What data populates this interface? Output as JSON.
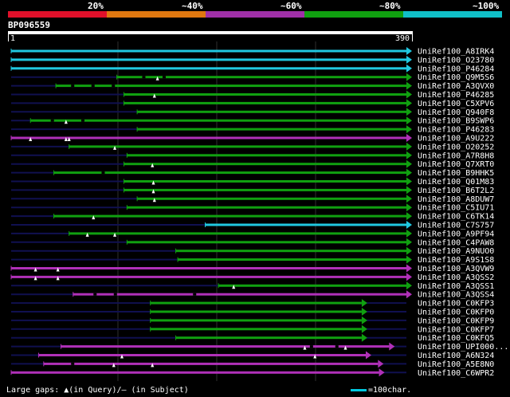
{
  "legend": {
    "labels": [
      "20%",
      "~40%",
      "~60%",
      "~80%",
      "~100%"
    ],
    "colors": [
      "#e0102a",
      "#e07810",
      "#a030a8",
      "#10a010",
      "#10c0c8"
    ]
  },
  "query": {
    "name": "BP096559",
    "start": "1",
    "end": "390",
    "length": 390
  },
  "colors": {
    "faint_line": "#101050",
    "gap_dash": "#000000",
    "gridline": "#303030"
  },
  "hits": [
    {
      "label": "UniRef100_A8IRK4",
      "color": "cyan",
      "start": 1,
      "end": 390,
      "arrow": "tri",
      "gaps": [],
      "marks": []
    },
    {
      "label": "UniRef100_O23780",
      "color": "cyan",
      "start": 1,
      "end": 390,
      "arrow": "tri",
      "gaps": [],
      "marks": []
    },
    {
      "label": "UniRef100_P46284",
      "color": "cyan",
      "start": 1,
      "end": 390,
      "arrow": "tri",
      "gaps": [],
      "marks": []
    },
    {
      "label": "UniRef100_Q9M5S6",
      "color": "green",
      "start": 105,
      "end": 390,
      "arrow": "tri",
      "gaps": [
        130,
        150
      ],
      "marks": [
        145
      ]
    },
    {
      "label": "UniRef100_A3QVX0",
      "color": "green",
      "start": 45,
      "end": 390,
      "arrow": "tri",
      "gaps": [
        60,
        80,
        100
      ],
      "marks": []
    },
    {
      "label": "UniRef100_P46285",
      "color": "green",
      "start": 112,
      "end": 390,
      "arrow": "tri",
      "gaps": [],
      "marks": [
        142
      ]
    },
    {
      "label": "UniRef100_C5XPV6",
      "color": "green",
      "start": 112,
      "end": 390,
      "arrow": "tri",
      "gaps": [],
      "marks": []
    },
    {
      "label": "UniRef100_Q940F8",
      "color": "green",
      "start": 125,
      "end": 390,
      "arrow": "tri",
      "gaps": [],
      "marks": []
    },
    {
      "label": "UniRef100_B9SWP6",
      "color": "green",
      "start": 20,
      "end": 390,
      "arrow": "tri",
      "gaps": [
        40,
        70
      ],
      "marks": [
        55
      ]
    },
    {
      "label": "UniRef100_P46283",
      "color": "green",
      "start": 125,
      "end": 390,
      "arrow": "tri",
      "gaps": [],
      "marks": []
    },
    {
      "label": "UniRef100_A9U222",
      "color": "magenta",
      "start": 1,
      "end": 390,
      "arrow": "tri",
      "gaps": [],
      "marks": [
        20,
        55,
        58
      ]
    },
    {
      "label": "UniRef100_O20252",
      "color": "green",
      "start": 58,
      "end": 390,
      "arrow": "tri",
      "gaps": [],
      "marks": [
        103
      ]
    },
    {
      "label": "UniRef100_A7R8H8",
      "color": "green",
      "start": 115,
      "end": 390,
      "arrow": "tri",
      "gaps": [],
      "marks": []
    },
    {
      "label": "UniRef100_Q7XRT0",
      "color": "green",
      "start": 112,
      "end": 390,
      "arrow": "tri",
      "gaps": [],
      "marks": [
        140
      ]
    },
    {
      "label": "UniRef100_B9HHK5",
      "color": "green",
      "start": 43,
      "end": 390,
      "arrow": "tri",
      "gaps": [
        90
      ],
      "marks": []
    },
    {
      "label": "UniRef100_Q01M83",
      "color": "green",
      "start": 112,
      "end": 390,
      "arrow": "tri",
      "gaps": [],
      "marks": [
        141
      ]
    },
    {
      "label": "UniRef100_B6T2L2",
      "color": "green",
      "start": 112,
      "end": 390,
      "arrow": "tri",
      "gaps": [],
      "marks": [
        141
      ]
    },
    {
      "label": "UniRef100_A8DUW7",
      "color": "green",
      "start": 125,
      "end": 390,
      "arrow": "tri",
      "gaps": [],
      "marks": [
        142
      ]
    },
    {
      "label": "UniRef100_C5IU71",
      "color": "green",
      "start": 115,
      "end": 390,
      "arrow": "tri",
      "gaps": [],
      "marks": []
    },
    {
      "label": "UniRef100_C6TK14",
      "color": "green",
      "start": 43,
      "end": 390,
      "arrow": "tri",
      "gaps": [],
      "marks": [
        82
      ]
    },
    {
      "label": "UniRef100_C7S757",
      "color": "cyan",
      "start": 192,
      "end": 390,
      "arrow": "tri",
      "gaps": [],
      "marks": []
    },
    {
      "label": "UniRef100_A9PF94",
      "color": "green",
      "start": 58,
      "end": 390,
      "arrow": "tri",
      "gaps": [],
      "marks": [
        76,
        103
      ]
    },
    {
      "label": "UniRef100_C4PAW8",
      "color": "green",
      "start": 115,
      "end": 390,
      "arrow": "tri",
      "gaps": [],
      "marks": []
    },
    {
      "label": "UniRef100_A9NUO0",
      "color": "green",
      "start": 163,
      "end": 390,
      "arrow": "tri",
      "gaps": [],
      "marks": []
    },
    {
      "label": "UniRef100_A9S1S8",
      "color": "green",
      "start": 165,
      "end": 390,
      "arrow": "tri",
      "gaps": [],
      "marks": []
    },
    {
      "label": "UniRef100_A3QVW9",
      "color": "magenta",
      "start": 1,
      "end": 390,
      "arrow": "tri",
      "gaps": [],
      "marks": [
        25,
        47
      ]
    },
    {
      "label": "UniRef100_A3QSS2",
      "color": "magenta",
      "start": 1,
      "end": 390,
      "arrow": "tri",
      "gaps": [],
      "marks": [
        25,
        47
      ]
    },
    {
      "label": "UniRef100_A3QSS1",
      "color": "green",
      "start": 205,
      "end": 390,
      "arrow": "tri",
      "gaps": [],
      "marks": [
        220
      ]
    },
    {
      "label": "UniRef100_A3QSS4",
      "color": "magenta",
      "start": 62,
      "end": 390,
      "arrow": "tri",
      "gaps": [
        82,
        102,
        180
      ],
      "marks": []
    },
    {
      "label": "UniRef100_C0KFP3",
      "color": "green",
      "start": 138,
      "end": 346,
      "arrow": "tri",
      "gaps": [],
      "marks": []
    },
    {
      "label": "UniRef100_C0KFP0",
      "color": "green",
      "start": 138,
      "end": 346,
      "arrow": "tri",
      "gaps": [],
      "marks": []
    },
    {
      "label": "UniRef100_C0KFP9",
      "color": "green",
      "start": 138,
      "end": 346,
      "arrow": "tri",
      "gaps": [],
      "marks": []
    },
    {
      "label": "UniRef100_C0KFP7",
      "color": "green",
      "start": 138,
      "end": 346,
      "arrow": "tri",
      "gaps": [],
      "marks": []
    },
    {
      "label": "UniRef100_C0KFQ5",
      "color": "green",
      "start": 163,
      "end": 346,
      "arrow": "tri",
      "gaps": [],
      "marks": []
    },
    {
      "label": "UniRef100_UPI000...",
      "color": "magenta",
      "start": 50,
      "end": 373,
      "arrow": "tri",
      "gaps": [
        295,
        320
      ],
      "marks": [
        290,
        330
      ]
    },
    {
      "label": "UniRef100_A6N324",
      "color": "magenta",
      "start": 28,
      "end": 350,
      "arrow": "tri",
      "gaps": [],
      "marks": [
        110,
        300
      ]
    },
    {
      "label": "UniRef100_A5E8N0",
      "color": "magenta",
      "start": 33,
      "end": 362,
      "arrow": "tri",
      "gaps": [
        60
      ],
      "marks": [
        102,
        140
      ]
    },
    {
      "label": "UniRef100_C6WPR2",
      "color": "magenta",
      "start": 1,
      "end": 363,
      "arrow": "tri",
      "gaps": [],
      "marks": []
    }
  ],
  "footer": {
    "gaps_text": "Large gaps: ▲(in Query)/– (in Subject)",
    "scale_text": "=100char."
  }
}
